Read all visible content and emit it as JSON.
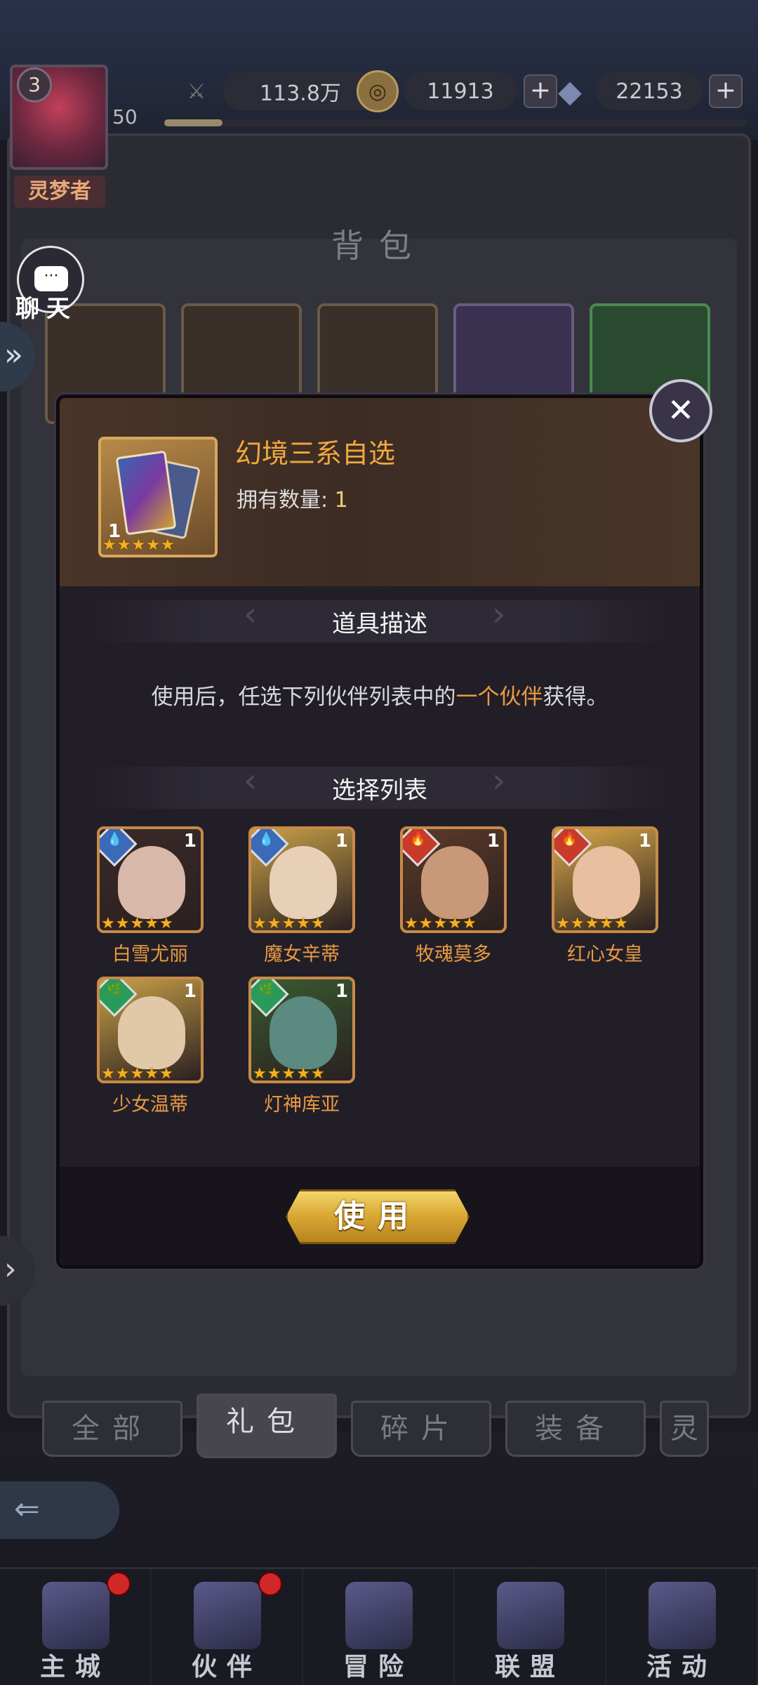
{
  "player": {
    "level": "3",
    "name": "灵梦者",
    "exp_level": "50",
    "exp_fraction": 0.1
  },
  "resources": {
    "power": "113.8万",
    "gold": "11913",
    "diamonds": "22153",
    "plus": "+"
  },
  "page": {
    "title": "背包"
  },
  "chat": {
    "label": "聊天",
    "bubble": "···"
  },
  "modal": {
    "item_name": "幻境三系自选",
    "owned_label": "拥有数量:",
    "owned_value": "1",
    "item_count": "1",
    "item_stars": 5,
    "desc_title": "道具描述",
    "desc_prefix": "使用后，任选下列伙伴列表中的",
    "desc_highlight": "一个伙伴",
    "desc_suffix": "获得。",
    "list_title": "选择列表",
    "use_button": "使用",
    "close_glyph": "✕",
    "heroes": [
      {
        "name": "白雪尤丽",
        "count": "1",
        "element": "water",
        "stars": 5
      },
      {
        "name": "魔女辛蒂",
        "count": "1",
        "element": "water",
        "stars": 5
      },
      {
        "name": "牧魂莫多",
        "count": "1",
        "element": "fire",
        "stars": 5
      },
      {
        "name": "红心女皇",
        "count": "1",
        "element": "fire",
        "stars": 5
      },
      {
        "name": "少女温蒂",
        "count": "1",
        "element": "wind",
        "stars": 5
      },
      {
        "name": "灯神库亚",
        "count": "1",
        "element": "wind",
        "stars": 5
      }
    ]
  },
  "tabs": [
    {
      "label": "全部",
      "active": false
    },
    {
      "label": "礼包",
      "active": true
    },
    {
      "label": "碎片",
      "active": false
    },
    {
      "label": "装备",
      "active": false
    },
    {
      "label": "灵",
      "active": false
    }
  ],
  "nav": [
    {
      "label": "主城",
      "dot": true,
      "icon": "castle-icon"
    },
    {
      "label": "伙伴",
      "dot": true,
      "icon": "witch-hat-icon"
    },
    {
      "label": "冒险",
      "dot": false,
      "icon": "compass-icon"
    },
    {
      "label": "联盟",
      "dot": false,
      "icon": "shield-icon"
    },
    {
      "label": "活动",
      "dot": false,
      "icon": "cards-icon"
    }
  ],
  "colors": {
    "accent_gold": "#f0a840",
    "water": "#3a6ab8",
    "fire": "#c83a2a",
    "wind": "#2a9a5a"
  }
}
